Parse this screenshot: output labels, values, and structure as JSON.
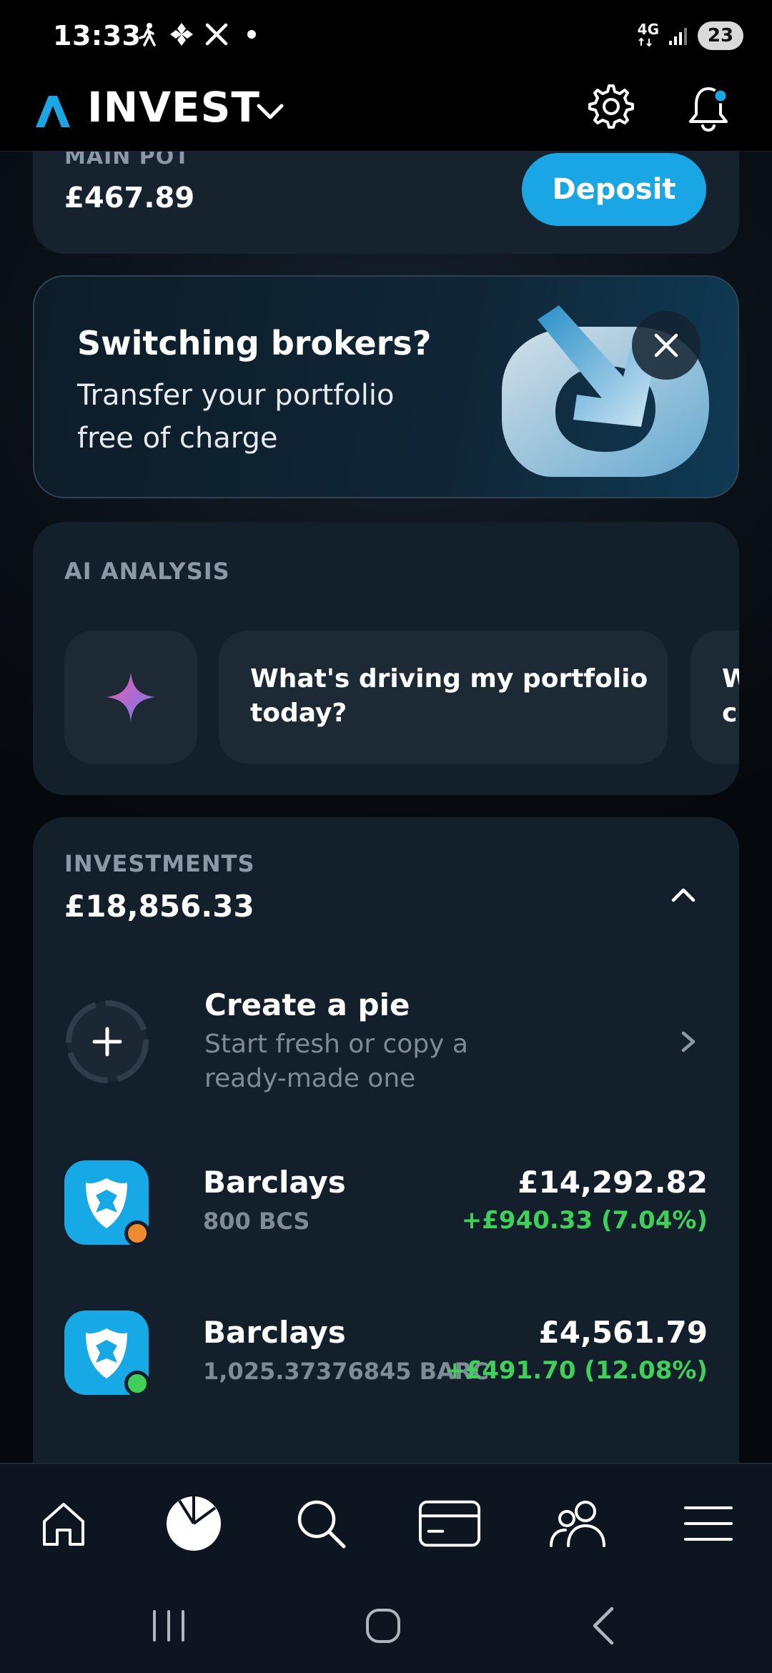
{
  "status_bar": {
    "time": "13:33",
    "network": "4G",
    "battery": "23"
  },
  "header": {
    "title": "INVEST",
    "accent_color": "#1aa6e4"
  },
  "main_pot": {
    "label": "MAIN POT",
    "value": "£467.89",
    "deposit_label": "Deposit"
  },
  "promo": {
    "title": "Switching brokers?",
    "subtitle": "Transfer your portfolio free of charge"
  },
  "ai_analysis": {
    "label": "AI ANALYSIS",
    "chips": [
      "What's driving my portfolio today?",
      "W\nc"
    ]
  },
  "investments": {
    "label": "INVESTMENTS",
    "value": "£18,856.33",
    "create_pie": {
      "title": "Create a pie",
      "subtitle": "Start fresh or copy a ready-made one"
    },
    "holdings": [
      {
        "name": "Barclays",
        "quantity": "800 BCS",
        "value": "£14,292.82",
        "change": "+£940.33 (7.04%)",
        "dot_color": "#f08a30"
      },
      {
        "name": "Barclays",
        "quantity": "1,025.37376845 BARC",
        "value": "£4,561.79",
        "change": "+£491.70 (12.08%)",
        "dot_color": "#3fcf5a"
      }
    ]
  },
  "colors": {
    "positive": "#3fcf5a",
    "brand": "#17a8e6"
  }
}
